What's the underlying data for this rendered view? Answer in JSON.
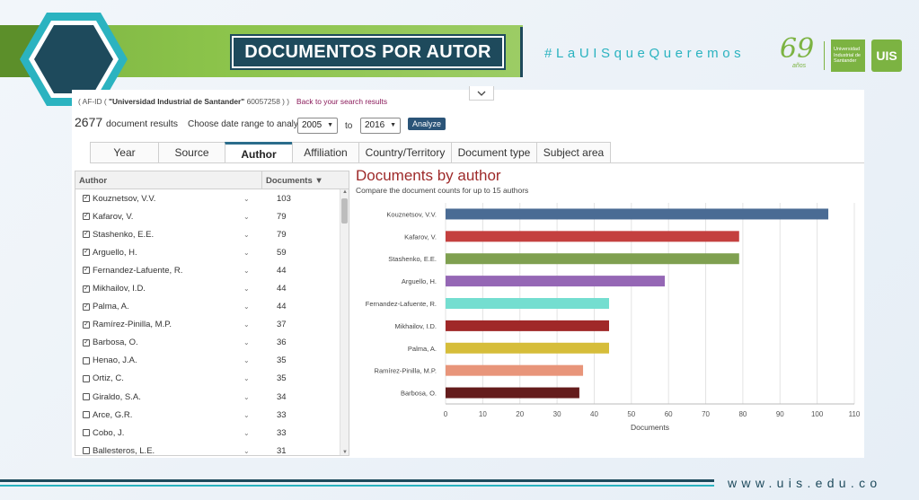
{
  "slide": {
    "title": "DOCUMENTOS POR AUTOR",
    "hashtag": "#LaUISqueQueremos",
    "logo_number": "69",
    "logo_sub": "años",
    "logo_text": "Universidad Industrial de Santander",
    "logo_badge": "UIS",
    "website": "www.uis.edu.co",
    "colors": {
      "green": "#7cb342",
      "navy": "#1e4a5c",
      "teal": "#2bb3c0"
    }
  },
  "query": {
    "prefix": "( AF-ID ( ",
    "affiliation": "\"Universidad Industrial de Santander\"",
    "suffix": "  60057258 ) )",
    "back_link": "Back to your search results",
    "collapse_icon": "chevron-down-icon"
  },
  "results": {
    "count": "2677",
    "count_label": "document results",
    "range_label": "Choose date range to analyze:",
    "from_year": "2005",
    "to_label": "to",
    "to_year": "2016",
    "analyze_label": "Analyze"
  },
  "tabs": [
    {
      "label": "Year",
      "active": false
    },
    {
      "label": "Source",
      "active": false
    },
    {
      "label": "Author",
      "active": true
    },
    {
      "label": "Affiliation",
      "active": false
    },
    {
      "label": "Country/Territory",
      "active": false
    },
    {
      "label": "Document type",
      "active": false
    },
    {
      "label": "Subject area",
      "active": false
    }
  ],
  "author_list": {
    "col_author": "Author",
    "col_documents": "Documents",
    "sort_icon": "sort-down-icon",
    "rows": [
      {
        "name": "Kouznetsov, V.V.",
        "count": "103",
        "checked": true
      },
      {
        "name": "Kafarov, V.",
        "count": "79",
        "checked": true
      },
      {
        "name": "Stashenko, E.E.",
        "count": "79",
        "checked": true
      },
      {
        "name": "Arguello, H.",
        "count": "59",
        "checked": true
      },
      {
        "name": "Fernandez-Lafuente, R.",
        "count": "44",
        "checked": true
      },
      {
        "name": "Mikhailov, I.D.",
        "count": "44",
        "checked": true
      },
      {
        "name": "Palma, A.",
        "count": "44",
        "checked": true
      },
      {
        "name": "Ramírez-Pinilla, M.P.",
        "count": "37",
        "checked": true
      },
      {
        "name": "Barbosa, O.",
        "count": "36",
        "checked": true
      },
      {
        "name": "Henao, J.A.",
        "count": "35",
        "checked": false
      },
      {
        "name": "Ortiz, C.",
        "count": "35",
        "checked": false
      },
      {
        "name": "Giraldo, S.A.",
        "count": "34",
        "checked": false
      },
      {
        "name": "Arce, G.R.",
        "count": "33",
        "checked": false
      },
      {
        "name": "Cobo, J.",
        "count": "33",
        "checked": false
      },
      {
        "name": "Ballesteros, L.E.",
        "count": "31",
        "checked": false
      }
    ]
  },
  "chart_data": {
    "type": "bar",
    "orientation": "horizontal",
    "title": "Documents by author",
    "subtitle": "Compare the document counts for up to 15 authors",
    "xlabel": "Documents",
    "ylabel": "",
    "xlim": [
      0,
      110
    ],
    "xticks": [
      0,
      10,
      20,
      30,
      40,
      50,
      60,
      70,
      80,
      90,
      100,
      110
    ],
    "grid": true,
    "categories": [
      "Kouznetsov, V.V.",
      "Kafarov, V.",
      "Stashenko, E.E.",
      "Arguello, H.",
      "Fernandez-Lafuente, R.",
      "Mikhailov, I.D.",
      "Palma, A.",
      "Ramírez-Pinilla, M.P.",
      "Barbosa, O."
    ],
    "values": [
      103,
      79,
      79,
      59,
      44,
      44,
      44,
      37,
      36
    ],
    "colors": [
      "#4a6b94",
      "#c4403f",
      "#7fa050",
      "#9567b5",
      "#74ded0",
      "#a02828",
      "#d6bd3a",
      "#e8957a",
      "#641c1c"
    ]
  }
}
